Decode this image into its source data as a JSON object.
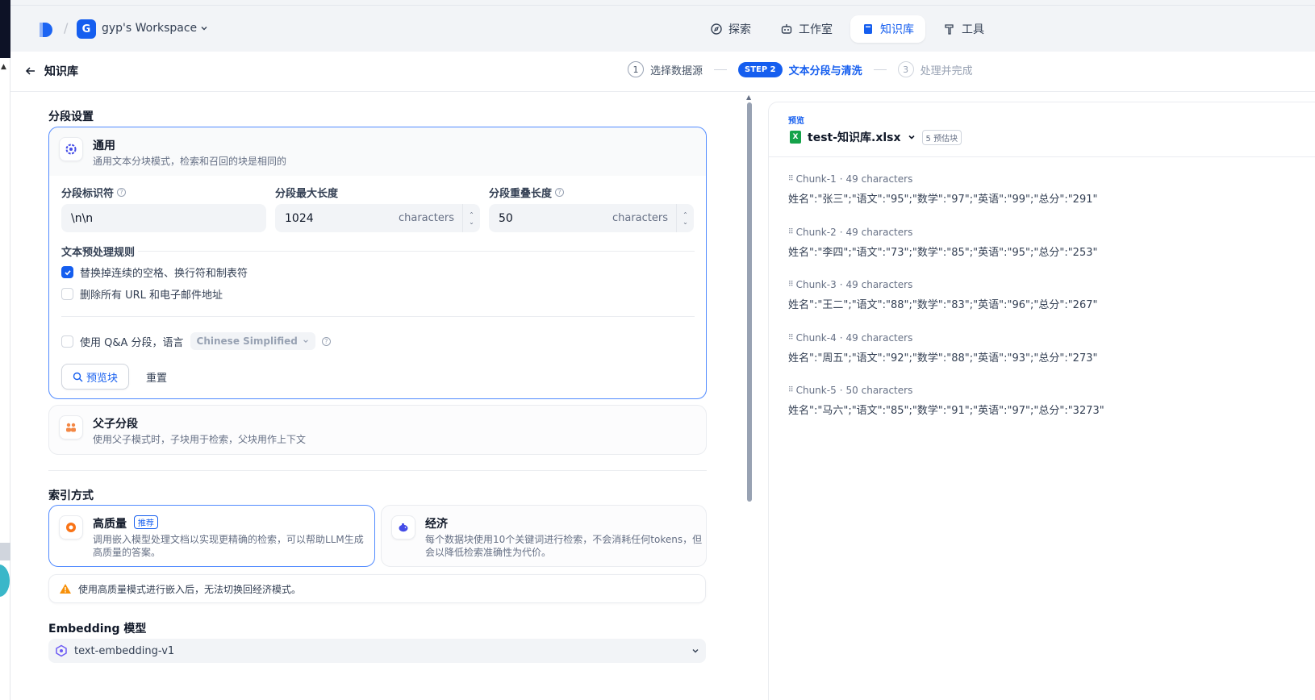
{
  "workspace": {
    "initial": "G",
    "name": "gyp's Workspace"
  },
  "nav": [
    {
      "label": "探索",
      "icon": "compass-icon",
      "active": false
    },
    {
      "label": "工作室",
      "icon": "robot-icon",
      "active": false
    },
    {
      "label": "知识库",
      "icon": "book-icon",
      "active": true
    },
    {
      "label": "工具",
      "icon": "hammer-icon",
      "active": false
    }
  ],
  "page": {
    "back_label": "知识库"
  },
  "steps": [
    {
      "num": "1",
      "label": "选择数据源"
    },
    {
      "num": "STEP 2",
      "label": "文本分段与清洗"
    },
    {
      "num": "3",
      "label": "处理并完成"
    }
  ],
  "segment": {
    "title": "分段设置",
    "general": {
      "title": "通用",
      "desc": "通用文本分块模式，检索和召回的块是相同的"
    },
    "separator": {
      "label": "分段标识符",
      "value": "\\n\\n"
    },
    "max_length": {
      "label": "分段最大长度",
      "value": "1024",
      "unit": "characters"
    },
    "overlap": {
      "label": "分段重叠长度",
      "value": "50",
      "unit": "characters"
    },
    "rules_title": "文本预处理规则",
    "rule_spaces": "替换掉连续的空格、换行符和制表符",
    "rule_urls": "删除所有 URL 和电子邮件地址",
    "qa_label": "使用 Q&A 分段，语言",
    "qa_lang": "Chinese Simplified",
    "preview_btn": "预览块",
    "reset_btn": "重置",
    "parent_child": {
      "title": "父子分段",
      "desc": "使用父子模式时，子块用于检索，父块用作上下文"
    }
  },
  "index": {
    "title": "索引方式",
    "high": {
      "title": "高质量",
      "badge": "推荐",
      "desc1": "调用嵌入模型处理文档以实现更精确的检索，可以帮助LLM生成",
      "desc2": "高质量的答案。"
    },
    "eco": {
      "title": "经济",
      "desc1": "每个数据块使用10个关键词进行检索，不会消耗任何tokens，但",
      "desc2": "会以降低检索准确性为代价。"
    },
    "warning": "使用高质量模式进行嵌入后，无法切换回经济模式。"
  },
  "embedding": {
    "title": "Embedding 模型",
    "model": "text-embedding-v1"
  },
  "preview": {
    "label": "预览",
    "file": "test-知识库.xlsx",
    "count": "5 预估块",
    "chunks": [
      {
        "id": "Chunk-1",
        "chars": "49 characters",
        "text": "姓名\":\"张三\";\"语文\":\"95\";\"数学\":\"97\";\"英语\":\"99\";\"总分\":\"291\""
      },
      {
        "id": "Chunk-2",
        "chars": "49 characters",
        "text": "姓名\":\"李四\";\"语文\":\"73\";\"数学\":\"85\";\"英语\":\"95\";\"总分\":\"253\""
      },
      {
        "id": "Chunk-3",
        "chars": "49 characters",
        "text": "姓名\":\"王二\";\"语文\":\"88\";\"数学\":\"83\";\"英语\":\"96\";\"总分\":\"267\""
      },
      {
        "id": "Chunk-4",
        "chars": "49 characters",
        "text": "姓名\":\"周五\";\"语文\":\"92\";\"数学\":\"88\";\"英语\":\"93\";\"总分\":\"273\""
      },
      {
        "id": "Chunk-5",
        "chars": "50 characters",
        "text": "姓名\":\"马六\";\"语文\":\"85\";\"数学\":\"91\";\"英语\":\"97\";\"总分\":\"3273\""
      }
    ]
  },
  "colors": {
    "accent": "#155eef",
    "border_selected": "#528bff",
    "warning": "#f79009"
  }
}
